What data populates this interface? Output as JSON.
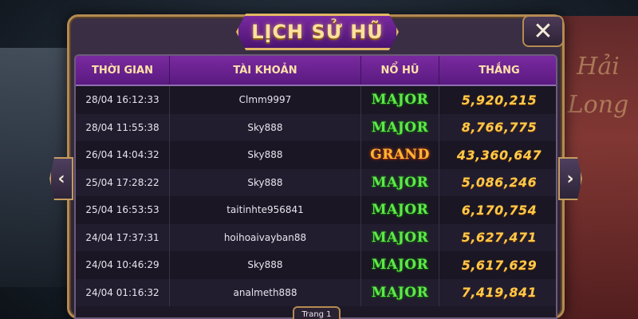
{
  "background": {
    "right_text": "Hải Long"
  },
  "dialog": {
    "title": "LỊCH SỬ HŨ",
    "close_icon": "close-icon",
    "close_glyph": "✕",
    "prev_glyph": "‹",
    "next_glyph": "›"
  },
  "table": {
    "headers": [
      "THỜI GIAN",
      "TÀI KHOẢN",
      "NỔ HŨ",
      "THẮNG"
    ],
    "rows": [
      {
        "time": "28/04 16:12:33",
        "account": "Clmm9997",
        "jackpot": "MAJOR",
        "win": "5,920,215"
      },
      {
        "time": "28/04 11:55:38",
        "account": "Sky888",
        "jackpot": "MAJOR",
        "win": "8,766,775"
      },
      {
        "time": "26/04 14:04:32",
        "account": "Sky888",
        "jackpot": "GRAND",
        "win": "43,360,647"
      },
      {
        "time": "25/04 17:28:22",
        "account": "Sky888",
        "jackpot": "MAJOR",
        "win": "5,086,246"
      },
      {
        "time": "25/04 16:53:53",
        "account": "taitinhte956841",
        "jackpot": "MAJOR",
        "win": "6,170,754"
      },
      {
        "time": "24/04 17:37:31",
        "account": "hoihoaivayban88",
        "jackpot": "MAJOR",
        "win": "5,627,471"
      },
      {
        "time": "24/04 10:46:29",
        "account": "Sky888",
        "jackpot": "MAJOR",
        "win": "5,617,629"
      },
      {
        "time": "24/04 01:16:32",
        "account": "analmeth888",
        "jackpot": "MAJOR",
        "win": "7,419,841"
      }
    ]
  },
  "pagination": {
    "label": "Trang 1"
  },
  "colors": {
    "major": "#5fe84a",
    "grand": "#ffb733",
    "win": "#ffc94a",
    "header": "#7a2aa0"
  }
}
